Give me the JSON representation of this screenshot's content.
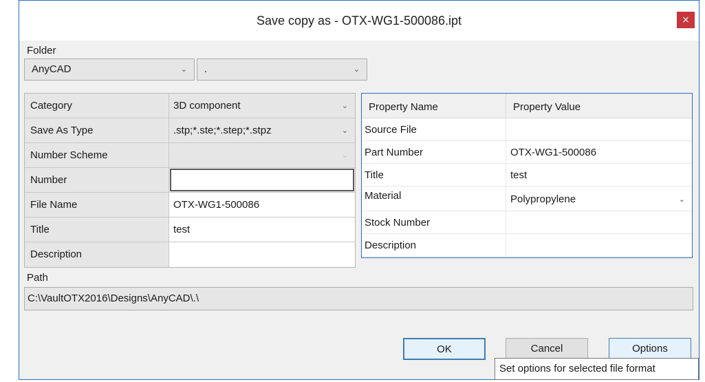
{
  "window": {
    "title": "Save copy as - OTX-WG1-500086.ipt",
    "close_glyph": "×"
  },
  "folder": {
    "label": "Folder",
    "primary": "AnyCAD",
    "secondary": "."
  },
  "left_grid": {
    "rows": [
      {
        "label": "Category",
        "value": "3D component"
      },
      {
        "label": "Save As Type",
        "value": ".stp;*.ste;*.step;*.stpz"
      },
      {
        "label": "Number Scheme",
        "value": ""
      },
      {
        "label": "Number",
        "value": ""
      },
      {
        "label": "File Name",
        "value": "OTX-WG1-500086"
      },
      {
        "label": "Title",
        "value": "test"
      },
      {
        "label": "Description",
        "value": ""
      }
    ]
  },
  "property_table": {
    "headers": [
      "Property Name",
      "Property Value"
    ],
    "rows": [
      {
        "name": "Source File",
        "value": ""
      },
      {
        "name": "Part Number",
        "value": "OTX-WG1-500086"
      },
      {
        "name": "Title",
        "value": "test"
      },
      {
        "name": "Material",
        "value": "Polypropylene"
      },
      {
        "name": "Stock Number",
        "value": ""
      },
      {
        "name": "Description",
        "value": ""
      }
    ]
  },
  "path": {
    "label": "Path",
    "value": "C:\\VaultOTX2016\\Designs\\AnyCAD\\.\\"
  },
  "buttons": {
    "ok": "OK",
    "cancel": "Cancel",
    "options": "Options"
  },
  "tooltip": "Set options for selected file format",
  "colors": {
    "accent": "#2b6cbf",
    "close": "#c8353a"
  }
}
